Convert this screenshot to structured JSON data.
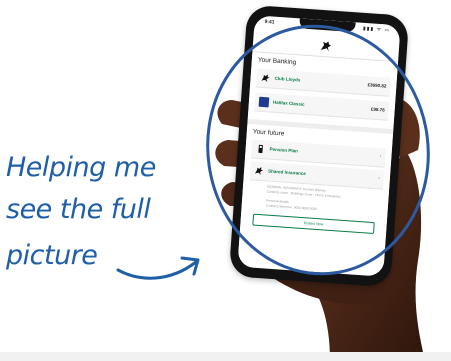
{
  "caption": {
    "line1": "Helping me",
    "line2": "see the full",
    "line3": "picture",
    "color": "#1f5ea8"
  },
  "phone": {
    "status": {
      "time": "9:41",
      "signal": "▮▮▮ ᯤ ▭"
    },
    "ranking": {
      "title": "Your Banking",
      "accounts": [
        {
          "name": "Club Lloyds",
          "amount": "£3690.82",
          "icon": "horse-logo-icon"
        },
        {
          "name": "Halifax Classic",
          "amount": "£98.76",
          "icon": "hx-logo-icon"
        }
      ]
    },
    "future": {
      "title": "Your future",
      "items": [
        {
          "name": "Pension Plan",
          "icon": "pension-icon"
        },
        {
          "name": "Shared Insurance",
          "icon": "horse-logo-icon"
        }
      ],
      "fine_lines": [
        "GENERAL INSURANCE Scottish Widows",
        "Contents cover · Buildings cover · Home Emergency",
        "Personal details",
        "Contract reference: 0000 0000 0000"
      ],
      "button": "Protect Now"
    },
    "colors": {
      "brand_green": "#0a7a47",
      "halifax_blue": "#1d3b8f"
    }
  },
  "highlight_circle_color": "#2c5aa0"
}
